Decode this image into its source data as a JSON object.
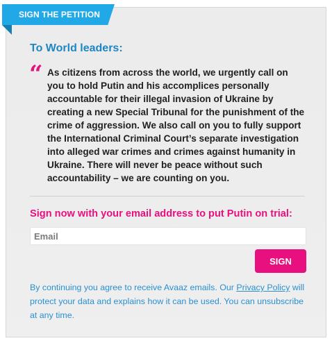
{
  "banner": {
    "label": "SIGN THE PETITION"
  },
  "petition": {
    "heading": "To World leaders:",
    "quote_mark": "“",
    "text": "As citizens from across the world, we urgently call on you to hold Putin and his accomplices personally accountable for their illegal invasion of Ukraine by creating a new Special Tribunal for the punishment of the crime of aggression. We also call on you to fully support the International Criminal Court’s separate investigation into alleged war crimes and crimes against humanity in Ukraine. There will never be peace without such accountability – we are counting on you."
  },
  "signup": {
    "heading": "Sign now with your email address to put Putin on trial:",
    "email_placeholder": "Email",
    "email_value": "",
    "button_label": "SIGN"
  },
  "disclaimer": {
    "before_link": "By continuing you agree to receive Avaaz emails. Our ",
    "link_text": "Privacy Policy",
    "after_link": " will protect your data and explains how it can be used. You can unsubscribe at any time."
  },
  "colors": {
    "ribbon": "#20a9e6",
    "heading_blue": "#1f86c4",
    "accent_pink": "#e8107e",
    "link_blue": "#2a8fcf"
  }
}
